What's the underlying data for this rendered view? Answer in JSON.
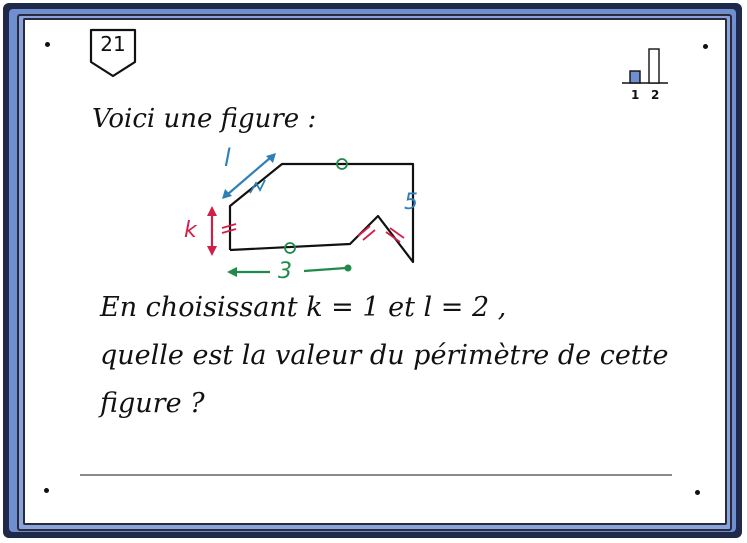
{
  "card": {
    "number": "21",
    "difficulty": {
      "labels": [
        "1",
        "2"
      ],
      "levels": [
        0.5,
        1.0
      ]
    }
  },
  "text": {
    "intro": "Voici une figure :",
    "question_line1": "En choisissant   k = 1  et  l = 2 ,",
    "question_line2": "quelle est la valeur du périmètre de cette",
    "question_line3": "figure ?"
  },
  "figure": {
    "labels": {
      "l": "l",
      "k": "k",
      "three": "3",
      "five": "5"
    }
  },
  "colors": {
    "blue": "#2f7fb8",
    "red": "#d0204a",
    "green": "#1f8a4a",
    "frame": "#6f8fd0"
  }
}
